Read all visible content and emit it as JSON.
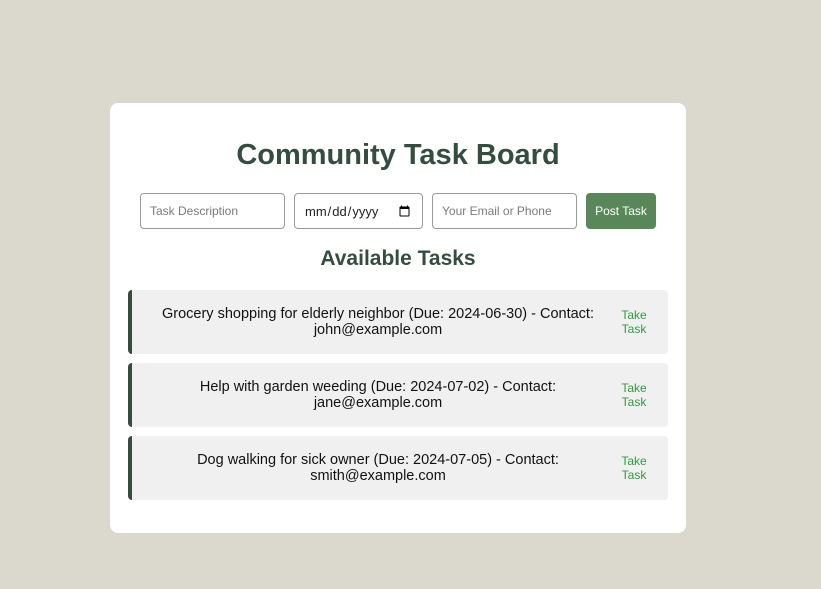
{
  "board": {
    "title": "Community Task Board",
    "subtitle": "Available Tasks"
  },
  "form": {
    "task_placeholder": "Task Description",
    "date_placeholder": "mm/dd/yyyy",
    "contact_placeholder": "Your Email or Phone",
    "post_label": "Post Task"
  },
  "tasks": [
    {
      "text": "Grocery shopping for elderly neighbor (Due: 2024-06-30) - Contact: john@example.com",
      "action": "Take Task"
    },
    {
      "text": "Help with garden weeding (Due: 2024-07-02) - Contact: jane@example.com",
      "action": "Take Task"
    },
    {
      "text": "Dog walking for sick owner (Due: 2024-07-05) - Contact: smith@example.com",
      "action": "Take Task"
    }
  ],
  "colors": {
    "background": "#dbd9cd",
    "heading": "#344d3e",
    "accent_button": "#598759",
    "action_link": "#2f9a3f"
  }
}
